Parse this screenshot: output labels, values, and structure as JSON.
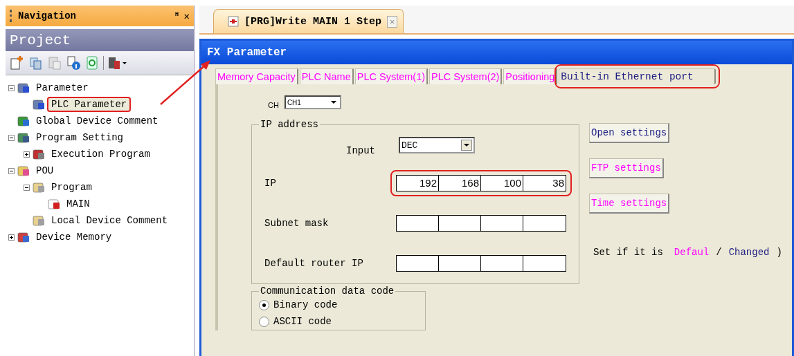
{
  "navigation": {
    "title": "Navigation",
    "pin": "ꟸ",
    "close": "✕",
    "project_title": "Project",
    "tree": [
      {
        "label": "Parameter",
        "kind": "param",
        "expanded": true,
        "highlighted": false,
        "children": [
          {
            "label": "PLC Parameter",
            "kind": "param",
            "highlighted": true,
            "selected": true
          }
        ]
      },
      {
        "label": "Global Device Comment",
        "kind": "comment",
        "highlighted": false
      },
      {
        "label": "Program Setting",
        "kind": "setting",
        "expanded": true,
        "highlighted": false,
        "children": [
          {
            "label": "Execution Program",
            "kind": "exec",
            "expanded": false,
            "highlighted": false
          }
        ]
      },
      {
        "label": "POU",
        "kind": "pou",
        "expanded": true,
        "highlighted": false,
        "children": [
          {
            "label": "Program",
            "kind": "folder",
            "expanded": true,
            "highlighted": false,
            "children": [
              {
                "label": "MAIN",
                "kind": "program",
                "highlighted": false
              }
            ]
          },
          {
            "label": "Local Device Comment",
            "kind": "folder",
            "highlighted": false
          }
        ]
      },
      {
        "label": "Device Memory",
        "kind": "memory",
        "expanded": false,
        "highlighted": false
      }
    ]
  },
  "document_tab": {
    "label": "[PRG]Write MAIN 1 Step",
    "close": "✕"
  },
  "dialog": {
    "title": "FX Parameter",
    "tabs": [
      {
        "label": "Memory Capacity",
        "selected": false,
        "changed": false,
        "highlighted": false
      },
      {
        "label": "PLC Name",
        "selected": false,
        "changed": false,
        "highlighted": false
      },
      {
        "label": "PLC System(1)",
        "selected": false,
        "changed": false,
        "highlighted": false
      },
      {
        "label": "PLC System(2)",
        "selected": false,
        "changed": false,
        "highlighted": false
      },
      {
        "label": "Positioning",
        "selected": false,
        "changed": false,
        "highlighted": false
      },
      {
        "label": "Built-in Ethernet port",
        "selected": true,
        "changed": true,
        "highlighted": true
      }
    ],
    "ch_label": "CH",
    "ch_value": "CH1",
    "ip_group": {
      "title": "IP address",
      "input_label": "Input",
      "input_value": "DEC",
      "rows": [
        {
          "label": "IP",
          "octets": [
            "192",
            "168",
            "100",
            "38"
          ],
          "highlighted": true
        },
        {
          "label": "Subnet mask",
          "highlighted": false
        },
        {
          "label": "Default router IP",
          "highlighted": false
        }
      ]
    },
    "buttons": [
      {
        "label": "Open settings",
        "changed": true
      },
      {
        "label": "FTP settings",
        "changed": false
      },
      {
        "label": "Time settings",
        "changed": false
      }
    ],
    "legend": {
      "prefix": "Set if it is",
      "default": "Defaul",
      "separator": "/",
      "changed": "Changed",
      "suffix": ")"
    },
    "code_group": {
      "title": "Communication data code",
      "options": [
        {
          "label": "Binary code",
          "selected": true
        },
        {
          "label": "ASCII code",
          "selected": false
        }
      ]
    }
  }
}
